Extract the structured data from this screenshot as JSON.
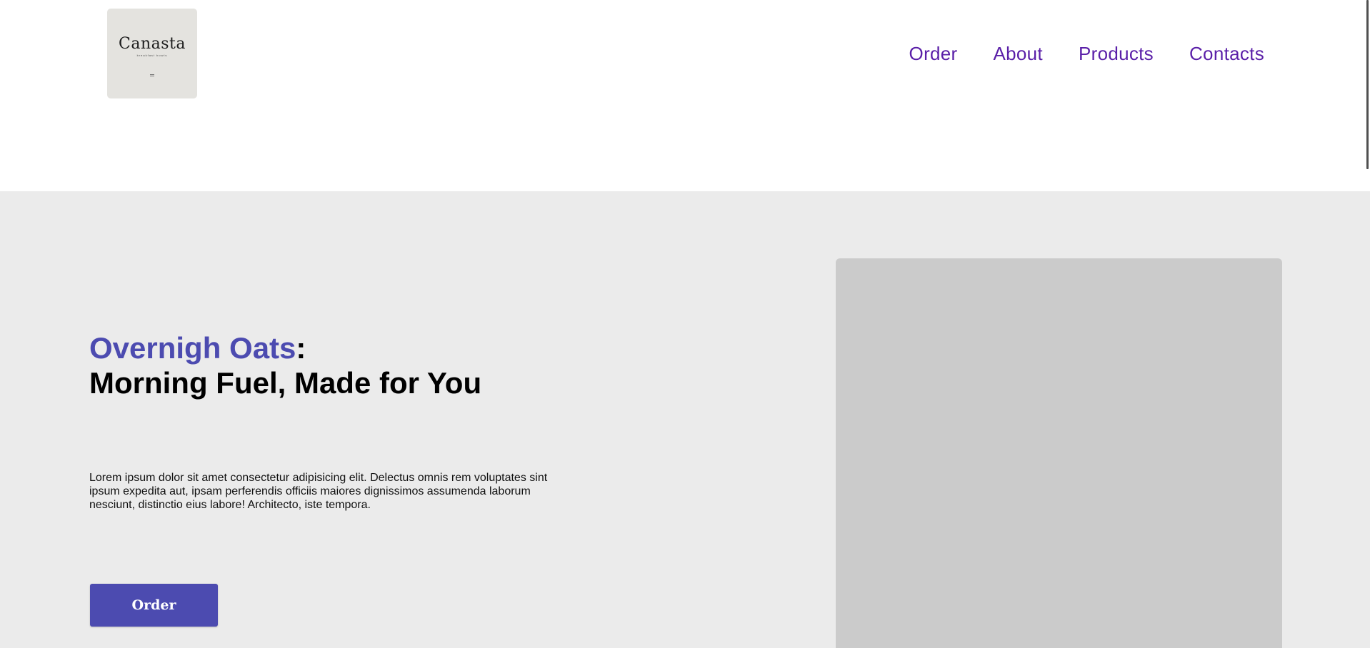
{
  "logo": {
    "wordmark": "Canasta",
    "tagline": "breakfast bowls"
  },
  "nav": {
    "items": [
      "Order",
      "About",
      "Products",
      "Contacts"
    ],
    "color": "#5a1fa8"
  },
  "hero": {
    "title_accent": "Overnigh Oats",
    "title_colon": ":",
    "title_line2": "Morning Fuel, Made for You",
    "body": "Lorem ipsum dolor sit amet consectetur adipisicing elit. Delectus omnis rem voluptates sint ipsum expedita aut, ipsam perferendis officiis maiores dignissimos assumenda laborum nesciunt, distinctio eius labore! Architecto, iste tempora.",
    "cta_label": "Order",
    "accent_color": "#4c4bb0",
    "background": "#ebebeb",
    "image_placeholder_color": "#cbcbcb"
  }
}
